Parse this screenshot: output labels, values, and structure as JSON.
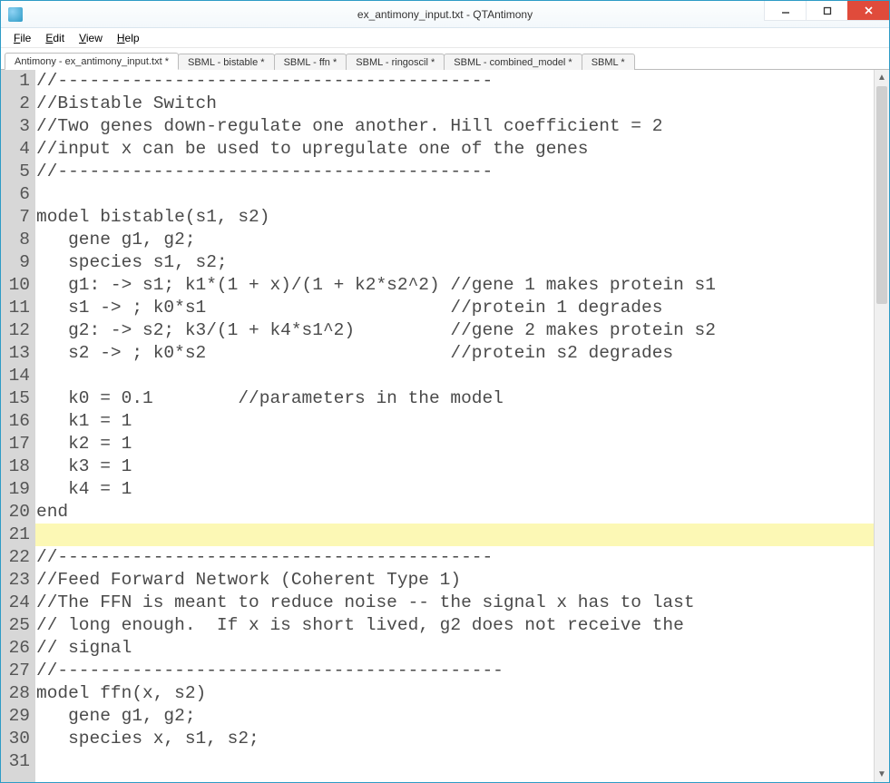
{
  "window": {
    "title": "ex_antimony_input.txt - QTAntimony"
  },
  "menu": {
    "file": "File",
    "edit": "Edit",
    "view": "View",
    "help": "Help"
  },
  "tabs": [
    {
      "label": "Antimony - ex_antimony_input.txt *",
      "active": true
    },
    {
      "label": "SBML - bistable *",
      "active": false
    },
    {
      "label": "SBML - ffn *",
      "active": false
    },
    {
      "label": "SBML - ringoscil *",
      "active": false
    },
    {
      "label": "SBML - combined_model *",
      "active": false
    },
    {
      "label": "SBML *",
      "active": false
    }
  ],
  "editor": {
    "highlighted_line_index": 20,
    "lines": [
      "//-----------------------------------------",
      "//Bistable Switch",
      "//Two genes down-regulate one another. Hill coefficient = 2",
      "//input x can be used to upregulate one of the genes",
      "//-----------------------------------------",
      "",
      "model bistable(s1, s2)",
      "   gene g1, g2;",
      "   species s1, s2;",
      "   g1: -> s1; k1*(1 + x)/(1 + k2*s2^2) //gene 1 makes protein s1",
      "   s1 -> ; k0*s1                       //protein 1 degrades",
      "   g2: -> s2; k3/(1 + k4*s1^2)         //gene 2 makes protein s2",
      "   s2 -> ; k0*s2                       //protein s2 degrades",
      "",
      "   k0 = 0.1        //parameters in the model",
      "   k1 = 1",
      "   k2 = 1",
      "   k3 = 1",
      "   k4 = 1",
      "end",
      "",
      "//-----------------------------------------",
      "//Feed Forward Network (Coherent Type 1)",
      "//The FFN is meant to reduce noise -- the signal x has to last",
      "// long enough.  If x is short lived, g2 does not receive the",
      "// signal",
      "//------------------------------------------",
      "model ffn(x, s2)",
      "   gene g1, g2;",
      "   species x, s1, s2;",
      ""
    ]
  }
}
